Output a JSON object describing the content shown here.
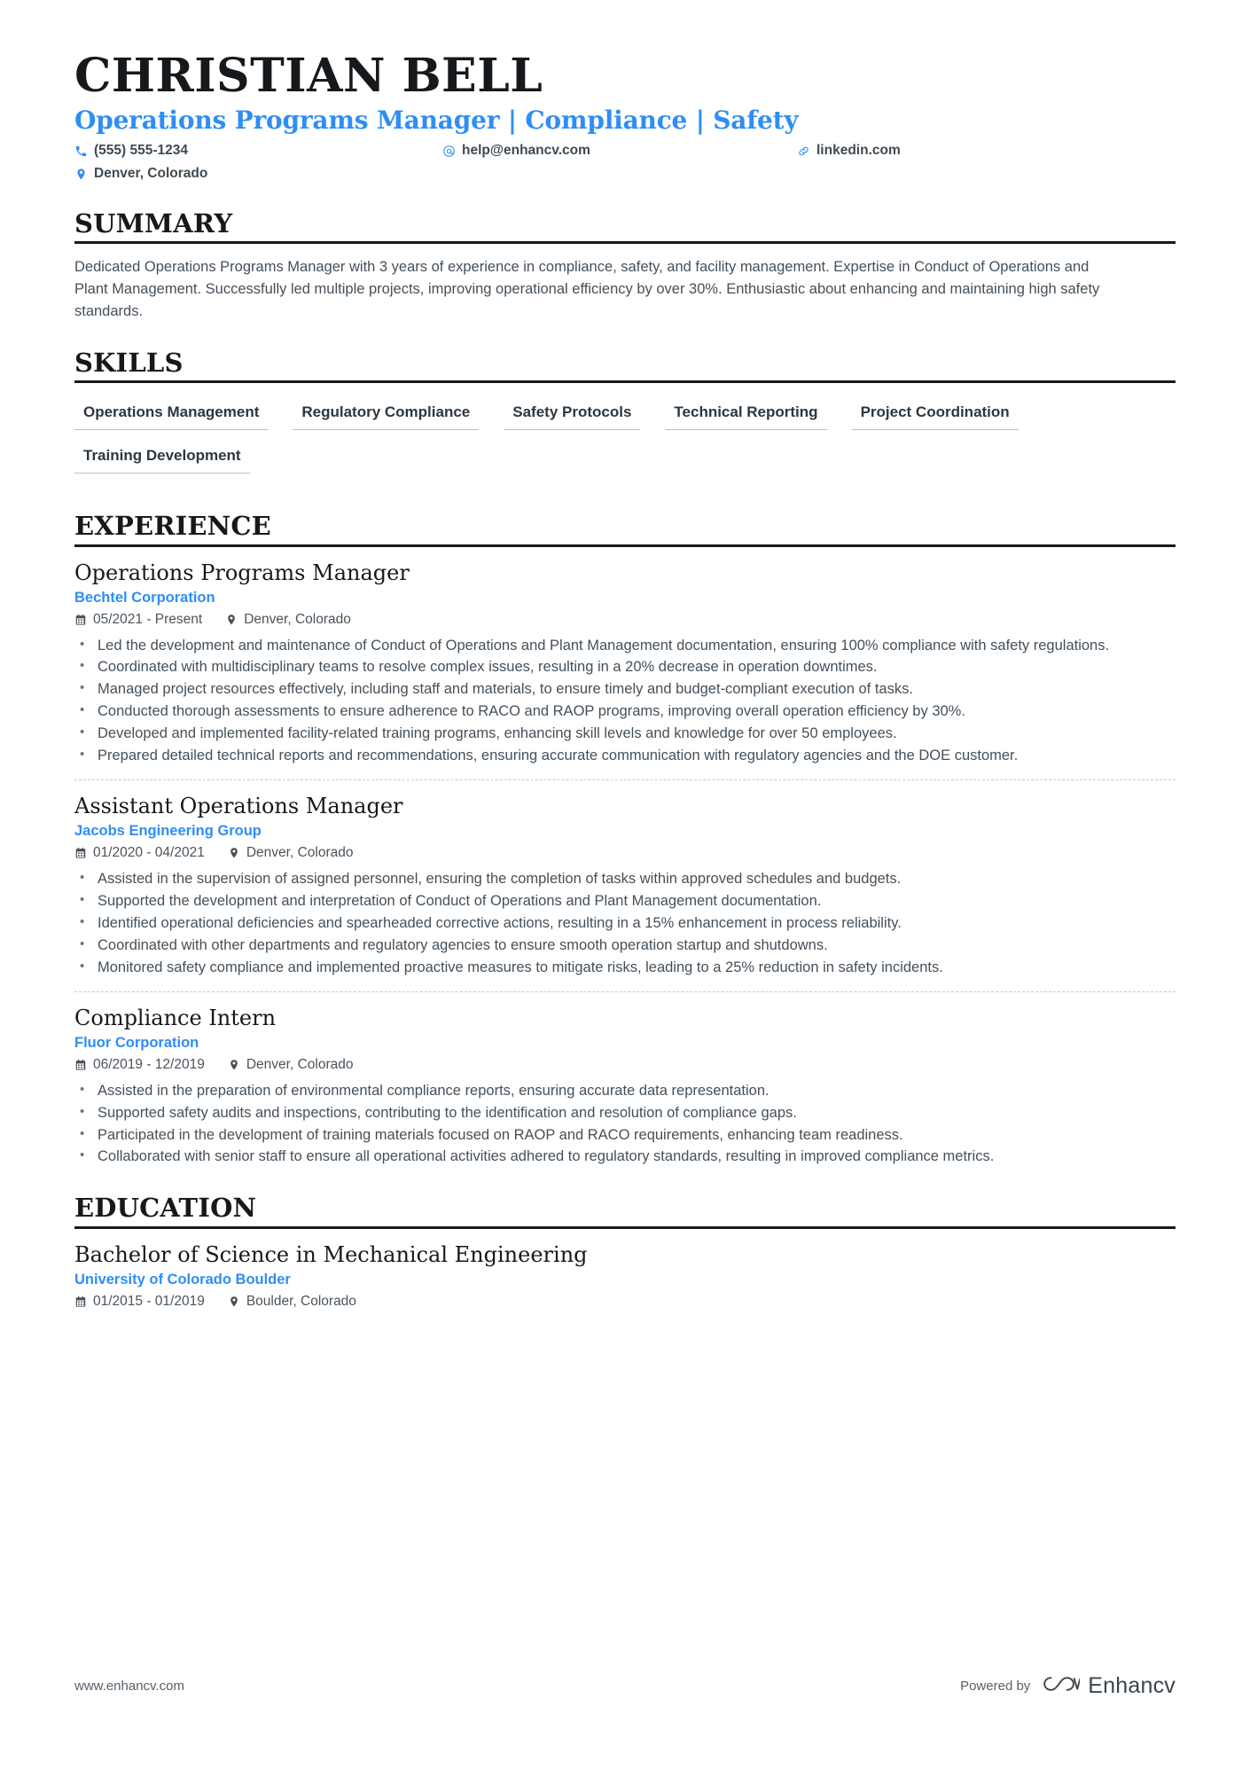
{
  "header": {
    "name": "CHRISTIAN BELL",
    "headline": "Operations Programs Manager | Compliance | Safety",
    "contacts": [
      {
        "icon": "phone-icon",
        "text": "(555) 555-1234"
      },
      {
        "icon": "email-icon",
        "text": "help@enhancv.com"
      },
      {
        "icon": "link-icon",
        "text": "linkedin.com"
      },
      {
        "icon": "location-pin-icon",
        "text": "Denver, Colorado"
      }
    ]
  },
  "sections": {
    "summary": {
      "title": "SUMMARY",
      "text": "Dedicated Operations Programs Manager with 3 years of experience in compliance, safety, and facility management. Expertise in Conduct of Operations and Plant Management. Successfully led multiple projects, improving operational efficiency by over 30%. Enthusiastic about enhancing and maintaining high safety standards."
    },
    "skills": {
      "title": "SKILLS",
      "items": [
        "Operations Management",
        "Regulatory Compliance",
        "Safety Protocols",
        "Technical Reporting",
        "Project Coordination",
        "Training Development"
      ]
    },
    "experience": {
      "title": "EXPERIENCE",
      "entries": [
        {
          "title": "Operations Programs Manager",
          "organization": "Bechtel Corporation",
          "dates": "05/2021 - Present",
          "location": "Denver, Colorado",
          "bullets": [
            "Led the development and maintenance of Conduct of Operations and Plant Management documentation, ensuring 100% compliance with safety regulations.",
            "Coordinated with multidisciplinary teams to resolve complex issues, resulting in a 20% decrease in operation downtimes.",
            "Managed project resources effectively, including staff and materials, to ensure timely and budget-compliant execution of tasks.",
            "Conducted thorough assessments to ensure adherence to RACO and RAOP programs, improving overall operation efficiency by 30%.",
            "Developed and implemented facility-related training programs, enhancing skill levels and knowledge for over 50 employees.",
            "Prepared detailed technical reports and recommendations, ensuring accurate communication with regulatory agencies and the DOE customer."
          ]
        },
        {
          "title": "Assistant Operations Manager",
          "organization": "Jacobs Engineering Group",
          "dates": "01/2020 - 04/2021",
          "location": "Denver, Colorado",
          "bullets": [
            "Assisted in the supervision of assigned personnel, ensuring the completion of tasks within approved schedules and budgets.",
            "Supported the development and interpretation of Conduct of Operations and Plant Management documentation.",
            "Identified operational deficiencies and spearheaded corrective actions, resulting in a 15% enhancement in process reliability.",
            "Coordinated with other departments and regulatory agencies to ensure smooth operation startup and shutdowns.",
            "Monitored safety compliance and implemented proactive measures to mitigate risks, leading to a 25% reduction in safety incidents."
          ]
        },
        {
          "title": "Compliance Intern",
          "organization": "Fluor Corporation",
          "dates": "06/2019 - 12/2019",
          "location": "Denver, Colorado",
          "bullets": [
            "Assisted in the preparation of environmental compliance reports, ensuring accurate data representation.",
            "Supported safety audits and inspections, contributing to the identification and resolution of compliance gaps.",
            "Participated in the development of training materials focused on RAOP and RACO requirements, enhancing team readiness.",
            "Collaborated with senior staff to ensure all operational activities adhered to regulatory standards, resulting in improved compliance metrics."
          ]
        }
      ]
    },
    "education": {
      "title": "EDUCATION",
      "entries": [
        {
          "title": "Bachelor of Science in Mechanical Engineering",
          "organization": "University of Colorado Boulder",
          "dates": "01/2015 - 01/2019",
          "location": "Boulder, Colorado"
        }
      ]
    }
  },
  "footer": {
    "url": "www.enhancv.com",
    "powered_by": "Powered by",
    "brand": "Enhancv"
  },
  "colors": {
    "accent": "#2f8ef4",
    "heading": "#16191c",
    "body": "#44505a"
  }
}
